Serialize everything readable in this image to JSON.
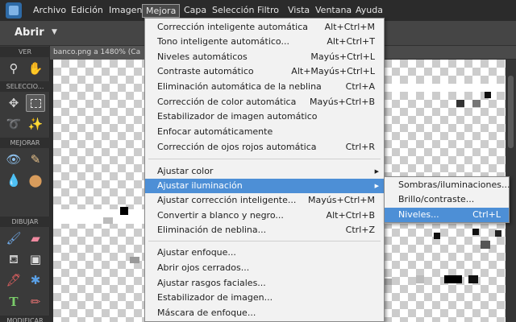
{
  "menubar": {
    "items": [
      "Archivo",
      "Edición",
      "Imagen",
      "Mejora",
      "Capa",
      "Selección",
      "Filtro",
      "Vista",
      "Ventana",
      "Ayuda"
    ],
    "active": "Mejora"
  },
  "options_bar": {
    "open_label": "Abrir"
  },
  "document": {
    "tab_label": "banco.png a 1480% (Ca"
  },
  "toolbox": {
    "sections": [
      "VER",
      "SELECCIO...",
      "MEJORAR",
      "DIBUJAR",
      "MODIFICAR"
    ],
    "tools": {
      "view": [
        "zoom-icon",
        "hand-icon"
      ],
      "select": [
        "move-icon",
        "marquee-icon",
        "lasso-icon",
        "magic-wand-icon"
      ],
      "enhance": [
        "red-eye-icon",
        "healing-brush-icon",
        "blur-icon",
        "sponge-icon"
      ],
      "draw": [
        "brush-icon",
        "eraser-icon",
        "paint-bucket-icon",
        "gradient-icon",
        "eyedropper-icon",
        "custom-shape-icon",
        "type-icon",
        "pencil-icon"
      ]
    }
  },
  "enhance_menu": {
    "group1": [
      {
        "label": "Corrección inteligente automática",
        "shortcut": "Alt+Ctrl+M"
      },
      {
        "label": "Tono inteligente automático...",
        "shortcut": "Alt+Ctrl+T"
      },
      {
        "label": "Niveles automáticos",
        "shortcut": "Mayús+Ctrl+L"
      },
      {
        "label": "Contraste automático",
        "shortcut": "Alt+Mayús+Ctrl+L"
      },
      {
        "label": "Eliminación automática de la neblina",
        "shortcut": "Ctrl+A"
      },
      {
        "label": "Corrección de color automática",
        "shortcut": "Mayús+Ctrl+B"
      },
      {
        "label": "Estabilizador de imagen automático",
        "shortcut": ""
      },
      {
        "label": "Enfocar automáticamente",
        "shortcut": ""
      },
      {
        "label": "Corrección de ojos rojos automática",
        "shortcut": "Ctrl+R"
      }
    ],
    "group2": [
      {
        "label": "Ajustar color",
        "shortcut": "",
        "submenu": true
      },
      {
        "label": "Ajustar iluminación",
        "shortcut": "",
        "submenu": true,
        "highlighted": true
      },
      {
        "label": "Ajustar corrección inteligente...",
        "shortcut": "Mayús+Ctrl+M"
      },
      {
        "label": "Convertir a blanco y negro...",
        "shortcut": "Alt+Ctrl+B"
      },
      {
        "label": "Eliminación de neblina...",
        "shortcut": "Ctrl+Z"
      }
    ],
    "group3": [
      {
        "label": "Ajustar enfoque...",
        "shortcut": ""
      },
      {
        "label": "Abrir ojos cerrados...",
        "shortcut": ""
      },
      {
        "label": "Ajustar rasgos faciales...",
        "shortcut": ""
      },
      {
        "label": "Estabilizador de imagen...",
        "shortcut": ""
      },
      {
        "label": "Máscara de enfoque...",
        "shortcut": ""
      }
    ]
  },
  "lighting_submenu": [
    {
      "label": "Sombras/iluminaciones...",
      "shortcut": ""
    },
    {
      "label": "Brillo/contraste...",
      "shortcut": ""
    },
    {
      "label": "Niveles...",
      "shortcut": "Ctrl+L",
      "highlighted": true
    }
  ],
  "colors": {
    "highlight": "#4d8fd6",
    "menu_bg": "#f2f2f2",
    "chrome_dark": "#2b2b2b"
  }
}
